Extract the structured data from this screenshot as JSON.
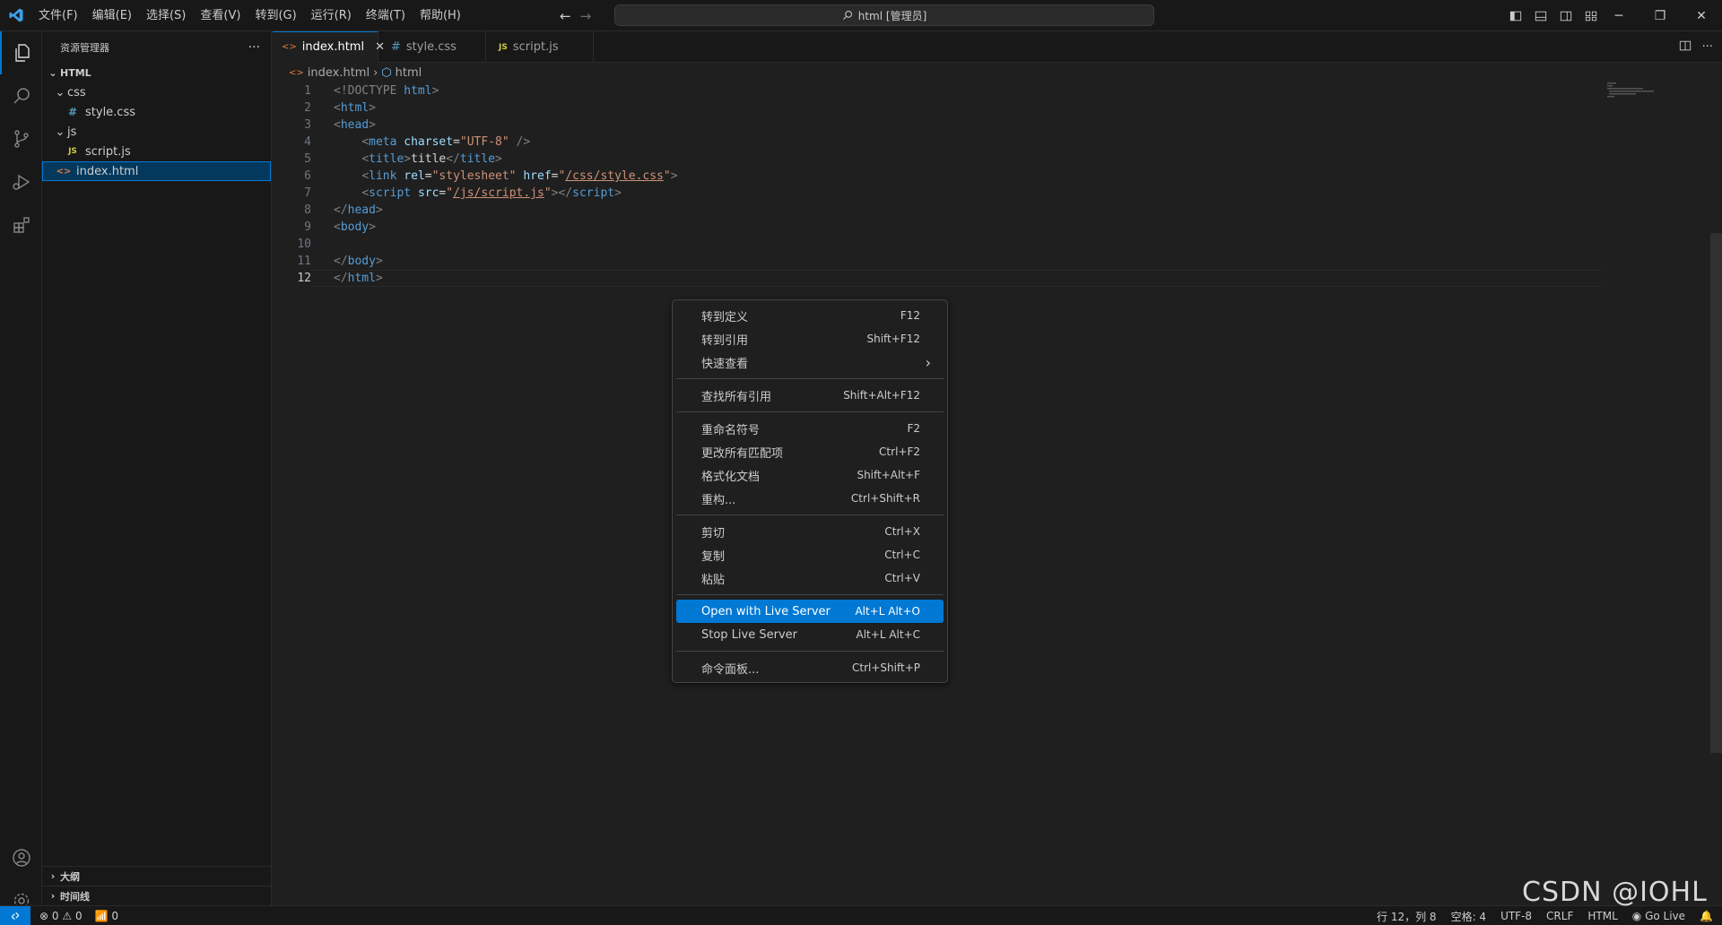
{
  "titlebar": {
    "menu": [
      "文件(F)",
      "编辑(E)",
      "选择(S)",
      "查看(V)",
      "转到(G)",
      "运行(R)",
      "终端(T)",
      "帮助(H)"
    ],
    "search_text": "html [管理员]"
  },
  "sidebar": {
    "title": "资源管理器",
    "more": "···",
    "tree": {
      "root": "HTML",
      "css_folder": "css",
      "style_file": "style.css",
      "js_folder": "js",
      "script_file": "script.js",
      "index_file": "index.html"
    },
    "outline": "大纲",
    "timeline": "时间线"
  },
  "tabs": [
    {
      "label": "index.html",
      "icon": "html-icon"
    },
    {
      "label": "style.css",
      "icon": "css-icon"
    },
    {
      "label": "script.js",
      "icon": "js-icon"
    }
  ],
  "breadcrumb": {
    "file": "index.html",
    "symbol": "html"
  },
  "code": {
    "line_numbers": [
      "1",
      "2",
      "3",
      "4",
      "5",
      "6",
      "7",
      "8",
      "9",
      "10",
      "11",
      "12"
    ],
    "doctype": "<!DOCTYPE",
    "doctype_name": "html",
    "html_open": "html",
    "head_open": "head",
    "meta_tag": "meta",
    "meta_attr": "charset",
    "meta_val": "\"UTF-8\"",
    "title_tag": "title",
    "title_text": "title",
    "link_tag": "link",
    "rel_attr": "rel",
    "rel_val": "\"stylesheet\"",
    "href_attr": "href",
    "href_val": "/css/style.css",
    "script_tag": "script",
    "src_attr": "src",
    "src_val": "/js/script.js",
    "head_close": "head",
    "body_open": "body",
    "body_close": "body",
    "html_close": "html"
  },
  "context_menu": {
    "groups": [
      [
        {
          "label": "转到定义",
          "key": "F12"
        },
        {
          "label": "转到引用",
          "key": "Shift+F12"
        },
        {
          "label": "快速查看",
          "key": "›"
        }
      ],
      [
        {
          "label": "查找所有引用",
          "key": "Shift+Alt+F12"
        }
      ],
      [
        {
          "label": "重命名符号",
          "key": "F2"
        },
        {
          "label": "更改所有匹配项",
          "key": "Ctrl+F2"
        },
        {
          "label": "格式化文档",
          "key": "Shift+Alt+F"
        },
        {
          "label": "重构...",
          "key": "Ctrl+Shift+R"
        }
      ],
      [
        {
          "label": "剪切",
          "key": "Ctrl+X"
        },
        {
          "label": "复制",
          "key": "Ctrl+C"
        },
        {
          "label": "粘贴",
          "key": "Ctrl+V"
        }
      ],
      [
        {
          "label": "Open with Live Server",
          "key": "Alt+L Alt+O"
        },
        {
          "label": "Stop Live Server",
          "key": "Alt+L Alt+C"
        }
      ],
      [
        {
          "label": "命令面板...",
          "key": "Ctrl+Shift+P"
        }
      ]
    ]
  },
  "statusbar": {
    "errors": "0",
    "warnings": "0",
    "ports": "0",
    "position": "行 12，列 8",
    "spaces": "空格: 4",
    "encoding": "UTF-8",
    "eol": "CRLF",
    "language": "HTML",
    "golive": "Go Live"
  },
  "watermark": "CSDN @IOHL",
  "colors": {
    "accent": "#0078d4",
    "background": "#1f1f1f",
    "sidebar": "#181818"
  }
}
